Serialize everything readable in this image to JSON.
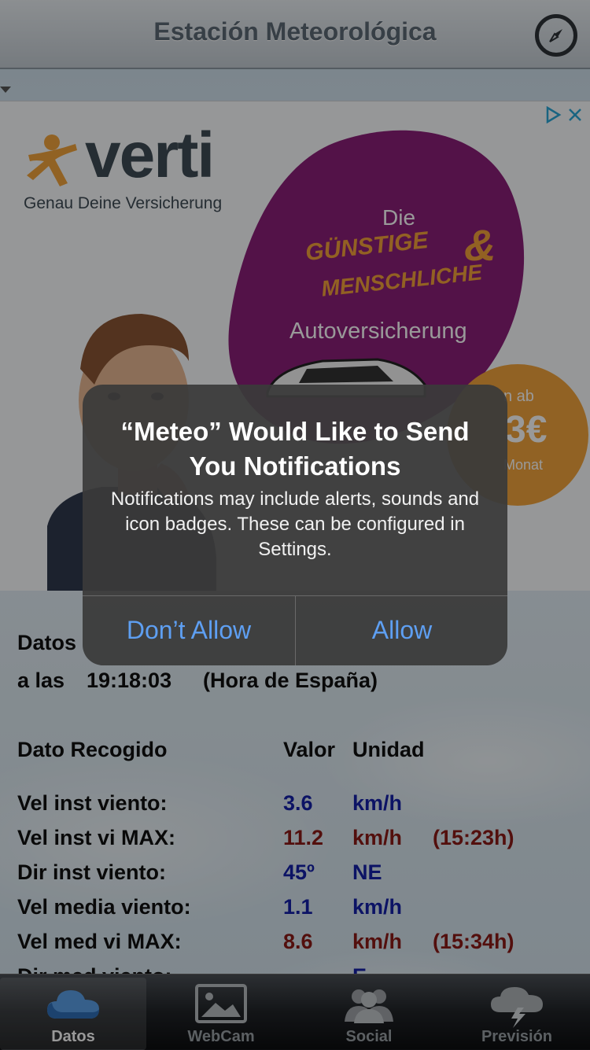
{
  "header": {
    "title": "Estación Meteorológica",
    "compass_icon": "compass-icon"
  },
  "ad": {
    "brand": "verti",
    "tagline": "Genau Deine Versicherung",
    "die": "Die",
    "guenstige": "GÜNSTIGE",
    "amp": "&",
    "menschliche": "MENSCHLICHE",
    "autoversicherung": "Autoversicherung",
    "price_prefix": "n ab",
    "price": "3€",
    "price_suffix": "Monat",
    "colors": {
      "purple": "#8a1f78",
      "orange": "#f2a43c"
    }
  },
  "data": {
    "datos_label": "Datos",
    "a_las": "a las",
    "time": "19:18:03",
    "timezone": "(Hora de España)",
    "col_dato": "Dato Recogido",
    "col_valor": "Valor",
    "col_unidad": "Unidad",
    "rows": [
      {
        "label": "Vel inst viento:",
        "value": "3.6",
        "unit": "km/h",
        "time": ""
      },
      {
        "label": "Vel inst vi MAX:",
        "value": "11.2",
        "unit": "km/h",
        "time": "(15:23h)"
      },
      {
        "label": "Dir inst viento:",
        "value": "45º",
        "unit": "NE",
        "time": ""
      },
      {
        "label": "Vel media viento:",
        "value": "1.1",
        "unit": "km/h",
        "time": ""
      },
      {
        "label": "Vel med vi MAX:",
        "value": "8.6",
        "unit": "km/h",
        "time": "(15:34h)"
      },
      {
        "label": "Dir med viento:",
        "value": "",
        "unit": "E",
        "time": ""
      }
    ]
  },
  "tabs": [
    {
      "label": "Datos",
      "icon": "cloud-icon",
      "active": true
    },
    {
      "label": "WebCam",
      "icon": "picture-icon",
      "active": false
    },
    {
      "label": "Social",
      "icon": "people-icon",
      "active": false
    },
    {
      "label": "Previsión",
      "icon": "storm-cloud-icon",
      "active": false
    }
  ],
  "alert": {
    "title": "“Meteo” Would Like to Send You Notifications",
    "message": "Notifications may include alerts, sounds and icon badges. These can be configured in Settings.",
    "dont_allow": "Don’t Allow",
    "allow": "Allow"
  }
}
